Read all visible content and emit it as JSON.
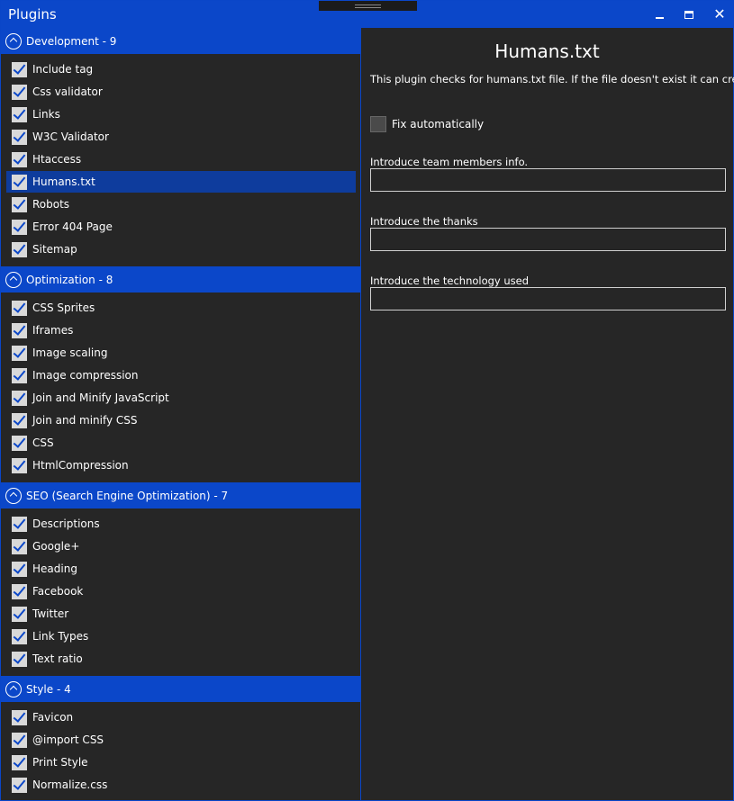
{
  "window": {
    "title": "Plugins"
  },
  "groups": [
    {
      "title": "Development - 9",
      "items": [
        {
          "label": "Include tag",
          "checked": true
        },
        {
          "label": "Css validator",
          "checked": true
        },
        {
          "label": "Links",
          "checked": true
        },
        {
          "label": "W3C Validator",
          "checked": true
        },
        {
          "label": "Htaccess",
          "checked": true
        },
        {
          "label": "Humans.txt",
          "checked": true,
          "selected": true
        },
        {
          "label": "Robots",
          "checked": true
        },
        {
          "label": "Error 404 Page",
          "checked": true
        },
        {
          "label": "Sitemap",
          "checked": true
        }
      ]
    },
    {
      "title": "Optimization - 8",
      "items": [
        {
          "label": "CSS Sprites",
          "checked": true
        },
        {
          "label": "Iframes",
          "checked": true
        },
        {
          "label": "Image scaling",
          "checked": true
        },
        {
          "label": "Image compression",
          "checked": true
        },
        {
          "label": "Join and Minify JavaScript",
          "checked": true
        },
        {
          "label": "Join and minify CSS",
          "checked": true
        },
        {
          "label": "CSS",
          "checked": true
        },
        {
          "label": "HtmlCompression",
          "checked": true
        }
      ]
    },
    {
      "title": "SEO (Search Engine Optimization) - 7",
      "items": [
        {
          "label": "Descriptions",
          "checked": true
        },
        {
          "label": "Google+",
          "checked": true
        },
        {
          "label": "Heading",
          "checked": true
        },
        {
          "label": "Facebook",
          "checked": true
        },
        {
          "label": "Twitter",
          "checked": true
        },
        {
          "label": "Link Types",
          "checked": true
        },
        {
          "label": "Text ratio",
          "checked": true
        }
      ]
    },
    {
      "title": "Style - 4",
      "items": [
        {
          "label": "Favicon",
          "checked": true
        },
        {
          "label": "@import CSS",
          "checked": true
        },
        {
          "label": "Print Style",
          "checked": true
        },
        {
          "label": "Normalize.css",
          "checked": true
        }
      ]
    }
  ],
  "detail": {
    "title": "Humans.txt",
    "description": "This plugin checks for humans.txt file. If the file doesn't exist it can create it",
    "fix_label": "Fix automatically",
    "fix_checked": false,
    "fields": [
      {
        "label": "Introduce team members info.",
        "value": ""
      },
      {
        "label": "Introduce the thanks",
        "value": ""
      },
      {
        "label": "Introduce the technology used",
        "value": ""
      }
    ]
  },
  "colors": {
    "accent": "#0b47c9",
    "selected": "#0e3c9d",
    "background": "#262626"
  }
}
